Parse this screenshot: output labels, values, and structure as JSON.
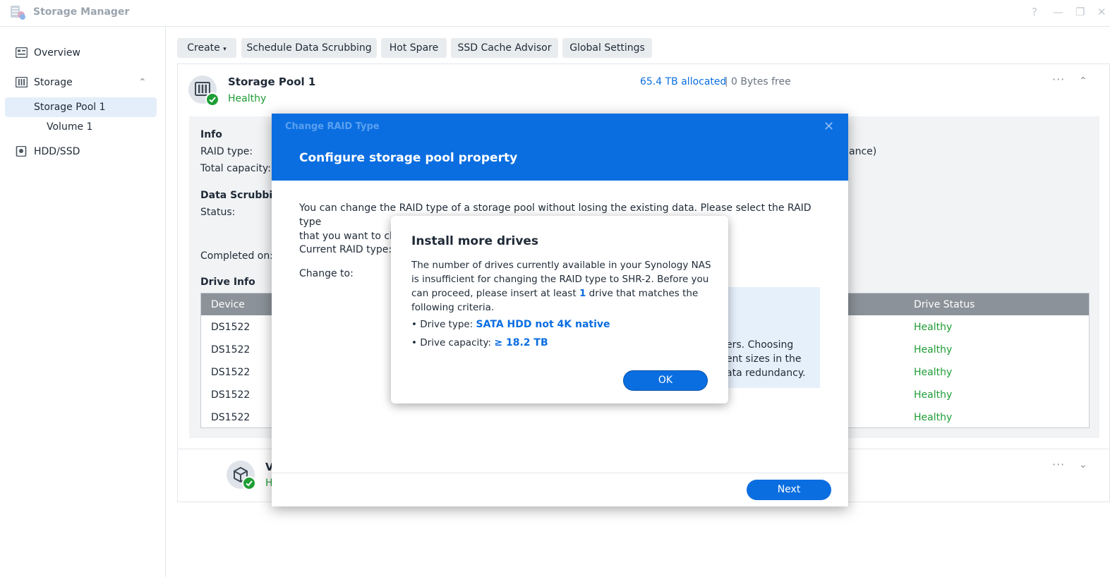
{
  "window": {
    "title": "Storage Manager",
    "help": "?",
    "minimize": "—",
    "restore": "❐",
    "close": "✕"
  },
  "sidebar": {
    "items": [
      {
        "label": "Overview"
      },
      {
        "label": "Storage"
      },
      {
        "label": "Storage Pool 1"
      },
      {
        "label": "Volume 1"
      },
      {
        "label": "HDD/SSD"
      }
    ],
    "storage_chevron": "⌃"
  },
  "toolbar": {
    "create": "Create",
    "create_caret": "▾",
    "scrub": "Schedule Data Scrubbing",
    "hot_spare": "Hot Spare",
    "ssd_cache": "SSD Cache Advisor",
    "global_settings": "Global Settings"
  },
  "pool": {
    "name": "Storage Pool 1",
    "status": "Healthy",
    "allocated": "65.4 TB allocated",
    "separator": "|",
    "free": "0 Bytes free",
    "more": "···",
    "collapse": "⌃",
    "info_heading": "Info",
    "raid_type_label": "RAID type:",
    "raid_type_tail": "ance)",
    "total_capacity_label": "Total capacity:",
    "scrub_heading": "Data Scrubbin",
    "scrub_status_label": "Status:",
    "completed_label": "Completed on:",
    "drive_info_heading": "Drive Info",
    "table": {
      "headers": [
        "Device",
        "Drive Status"
      ],
      "rows": [
        {
          "device": "DS1522",
          "status": "Healthy"
        },
        {
          "device": "DS1522",
          "status": "Healthy"
        },
        {
          "device": "DS1522",
          "status": "Healthy"
        },
        {
          "device": "DS1522",
          "status": "Healthy"
        },
        {
          "device": "DS1522",
          "status": "Healthy"
        }
      ]
    }
  },
  "volume_card": {
    "name_fragment": "V",
    "status_fragment": "H",
    "more": "···",
    "expand": "⌄"
  },
  "dialog": {
    "window_title": "Change RAID Type",
    "heading": "Configure storage pool property",
    "close": "✕",
    "intro_line1": "You can change the RAID type of a storage pool without losing the existing data. Please select the RAID type",
    "intro_line2": "that you want to ch",
    "current_raid_label": "Current RAID type:",
    "change_to_label": "Change to:",
    "info_lines": [
      "ers. Choosing",
      "ent sizes in the",
      "ata redundancy."
    ],
    "next_button": "Next"
  },
  "alert": {
    "title": "Install more drives",
    "body_line1": "The number of drives currently available in your Synology NAS",
    "body_line2": "is insufficient for changing the RAID type to SHR-2. Before you",
    "body_line3_pre": "can proceed, please insert at least ",
    "body_line3_num": "1",
    "body_line3_post": " drive that matches the",
    "body_line4": "following criteria.",
    "criteria": [
      {
        "label": "• Drive type: ",
        "value": "SATA HDD not 4K native"
      },
      {
        "label": "• Drive capacity: ",
        "value": "≥ 18.2 TB"
      }
    ],
    "ok_button": "OK"
  },
  "colors": {
    "accent": "#0b6ee0",
    "healthy": "#1e9e35",
    "selected_bg": "#e4eefa",
    "table_header": "#8b9299"
  }
}
